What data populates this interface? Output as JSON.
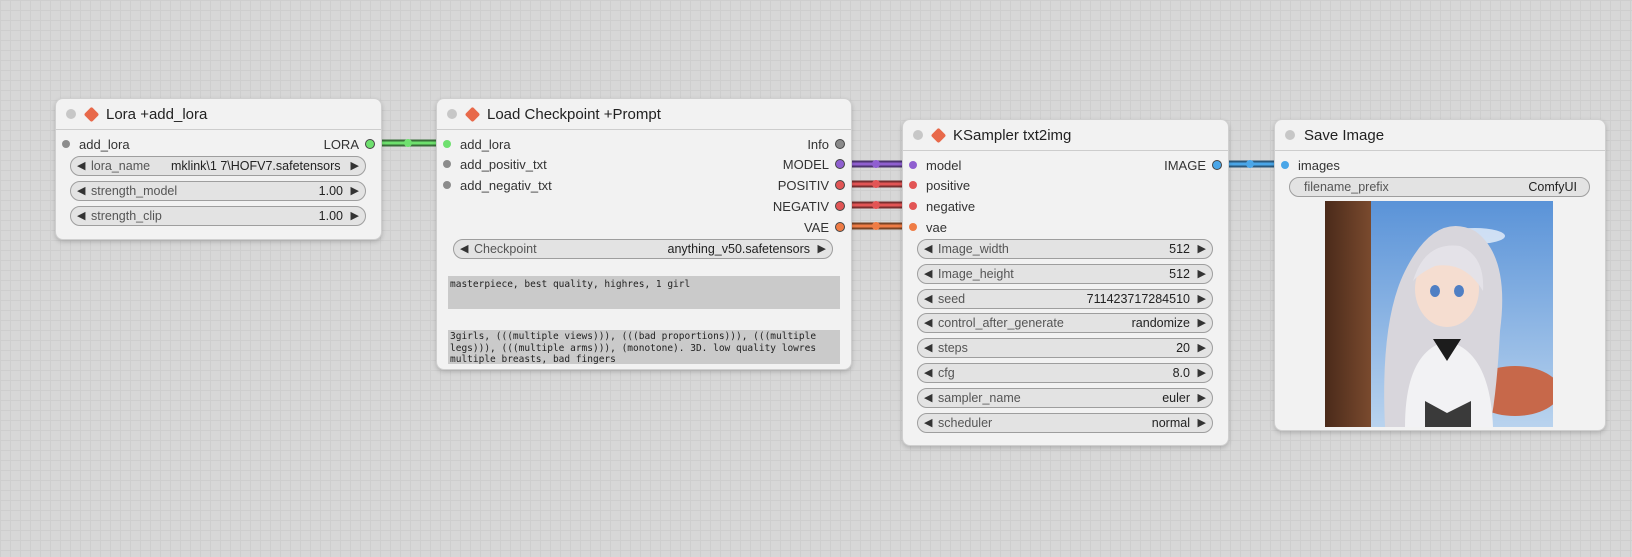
{
  "colors": {
    "lora": "#6ee06e",
    "model": "#8f5fd0",
    "conditioning": "#e25555",
    "vae": "#ef7c45",
    "image": "#4aa6e8",
    "node_accent": "#e8694a"
  },
  "nodes": {
    "lora": {
      "title": "Lora +add_lora",
      "inputs": [
        "add_lora"
      ],
      "output": "LORA",
      "widgets": [
        {
          "name": "lora_name",
          "value": "mklink\\1 7\\HOFV7.safetensors"
        },
        {
          "name": "strength_model",
          "value": "1.00"
        },
        {
          "name": "strength_clip",
          "value": "1.00"
        }
      ]
    },
    "checkpoint": {
      "title": "Load Checkpoint +Prompt",
      "inputs": [
        "add_lora",
        "add_positiv_txt",
        "add_negativ_txt"
      ],
      "outputs": [
        "Info",
        "MODEL",
        "POSITIV",
        "NEGATIV",
        "VAE"
      ],
      "widget": {
        "name": "Checkpoint",
        "value": "anything_v50.safetensors"
      },
      "positive_text": "masterpiece, best quality, highres, 1 girl",
      "negative_text": "3girls, (((multiple views))), (((bad proportions))), (((multiple\nlegs))), (((multiple arms))), (monotone). 3D. low quality lowres\nmultiple breasts, bad fingers"
    },
    "ksampler": {
      "title": "KSampler txt2img",
      "inputs": [
        "model",
        "positive",
        "negative",
        "vae"
      ],
      "output": "IMAGE",
      "widgets": [
        {
          "name": "Image_width",
          "value": "512"
        },
        {
          "name": "Image_height",
          "value": "512"
        },
        {
          "name": "seed",
          "value": "711423717284510"
        },
        {
          "name": "control_after_generate",
          "value": "randomize"
        },
        {
          "name": "steps",
          "value": "20"
        },
        {
          "name": "cfg",
          "value": "8.0"
        },
        {
          "name": "sampler_name",
          "value": "euler"
        },
        {
          "name": "scheduler",
          "value": "normal"
        }
      ]
    },
    "save": {
      "title": "Save Image",
      "input": "images",
      "widget": {
        "name": "filename_prefix",
        "value": "ComfyUI"
      }
    }
  }
}
